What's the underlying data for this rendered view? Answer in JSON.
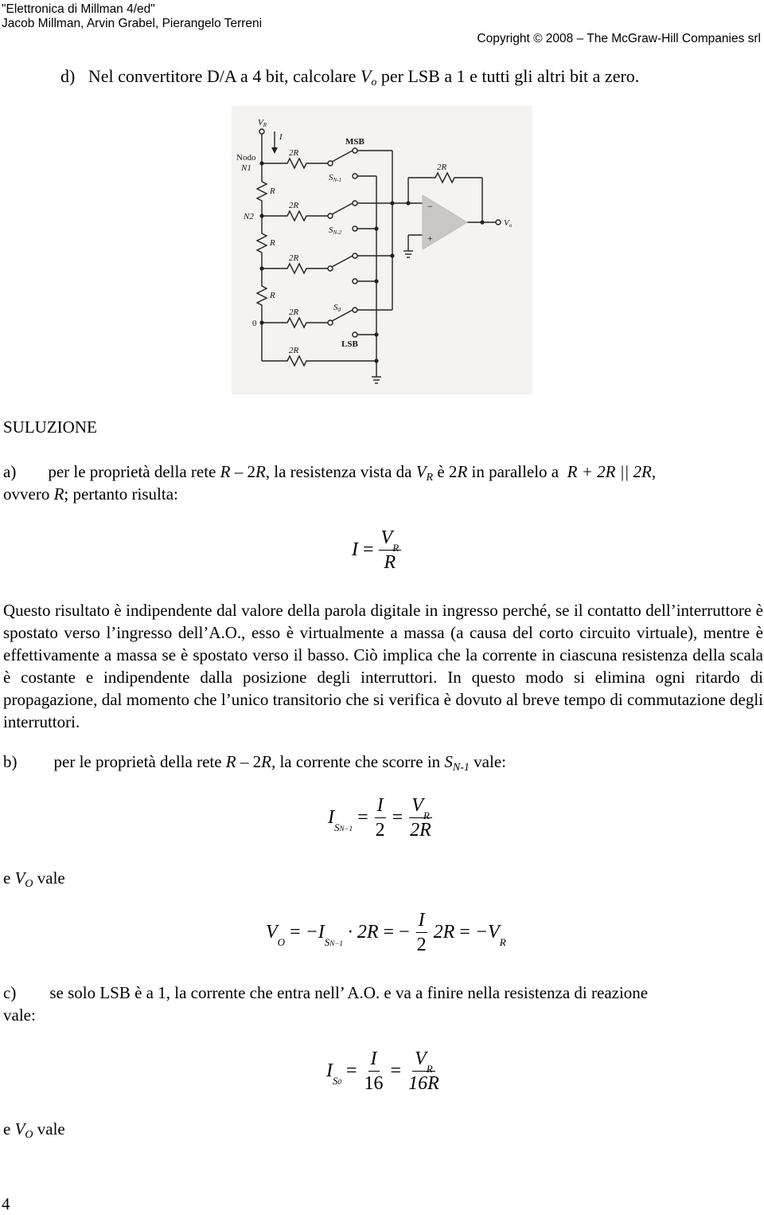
{
  "header": {
    "book_title": "\"Elettronica di Millman 4/ed\"",
    "authors": "Jacob Millman, Arvin Grabel, Pierangelo Terreni",
    "copyright": "Copyright © 2008 – The McGraw-Hill Companies srl"
  },
  "question": {
    "label": "d)",
    "text_before": "Nel convertitore D/A a 4 bit, calcolare ",
    "var": "V",
    "var_sub": "o",
    "text_after": " per LSB a 1 e tutti gli altri bit a zero."
  },
  "circuit": {
    "labels": {
      "vr": "V",
      "vr_sub": "R",
      "current": "I",
      "nodo": "Nodo",
      "n1": "N1",
      "n2": "N2",
      "zero": "0",
      "msb": "MSB",
      "lsb": "LSB",
      "sn1": "S",
      "sn1_sub": "N-1",
      "sn2": "S",
      "sn2_sub": "N-2",
      "s0": "S",
      "s0_sub": "0",
      "r": "R",
      "r2": "2R",
      "vo": "V",
      "vo_sub": "o",
      "minus": "−",
      "plus": "+"
    }
  },
  "solution": {
    "heading": "SULUZIONE",
    "a": {
      "label": "a)",
      "line1_p1": "per le proprietà della rete ",
      "line1_r": "R",
      "line1_p2": " – 2",
      "line1_r2": "R",
      "line1_p3": ", la resistenza vista da ",
      "line1_vr": "V",
      "line1_vr_sub": "R",
      "line1_p4": " è 2",
      "line1_r3": "R",
      "line1_p5": " in parallelo a ",
      "line1_expr": "R + 2R || 2R",
      "line1_end": ",",
      "line2_p1": "ovvero ",
      "line2_r": "R",
      "line2_p2": "; pertanto risulta:",
      "eq_lhs": "I",
      "eq_eq": "=",
      "eq_num": "V",
      "eq_num_sub": "R",
      "eq_den": "R"
    },
    "paragraph": "Questo risultato è indipendente dal valore della parola digitale in ingresso perché, se il contatto dell’interruttore è spostato verso l’ingresso dell’A.O., esso è virtualmente a massa (a causa del corto circuito virtuale), mentre è effettivamente a massa se è spostato verso il basso. Ciò implica che la corrente in ciascuna resistenza della scala è costante e indipendente dalla posizione degli interruttori. In questo modo si elimina ogni ritardo di propagazione, dal momento che l’unico transitorio che si verifica è dovuto al breve tempo di commutazione degli interruttori.",
    "b": {
      "label": "b)",
      "text_p1": "per le proprietà della rete ",
      "text_r": "R",
      "text_p2": " – 2",
      "text_r2": "R,",
      "text_p3": " la corrente che scorre in ",
      "text_s": "S",
      "text_s_sub": "N-1",
      "text_p4": " vale:",
      "eq1_lhs": "I",
      "eq1_lhs_sub": "S",
      "eq1_lhs_subsub": "N−1",
      "eq1_f1_num": "I",
      "eq1_f1_den": "2",
      "eq1_f2_num": "V",
      "eq1_f2_num_sub": "R",
      "eq1_f2_den": "2R",
      "vo_text_p1": "e ",
      "vo_var": "V",
      "vo_sub": "O",
      "vo_text_p2": " vale",
      "eq2_lhs": "V",
      "eq2_lhs_sub": "O",
      "eq2_t1": "−I",
      "eq2_t1_sub": "S",
      "eq2_t1_subsub": "N−1",
      "eq2_dot": "· 2R",
      "eq2_f_num": "I",
      "eq2_f_den": "2",
      "eq2_t2": "2R",
      "eq2_rhs": "−V",
      "eq2_rhs_sub": "R"
    },
    "c": {
      "label": "c)",
      "text": "se solo LSB è a 1, la corrente che entra nell’ A.O. e va a finire nella resistenza di reazione",
      "text2": "vale:",
      "eq_lhs": "I",
      "eq_lhs_sub": "S",
      "eq_lhs_subsub": "0",
      "eq_f1_num": "I",
      "eq_f1_den": "16",
      "eq_f2_num": "V",
      "eq_f2_num_sub": "R",
      "eq_f2_den": "16R",
      "vo_text_p1": "e ",
      "vo_var": "V",
      "vo_sub": "O",
      "vo_text_p2": " vale"
    }
  },
  "page_number": "4"
}
